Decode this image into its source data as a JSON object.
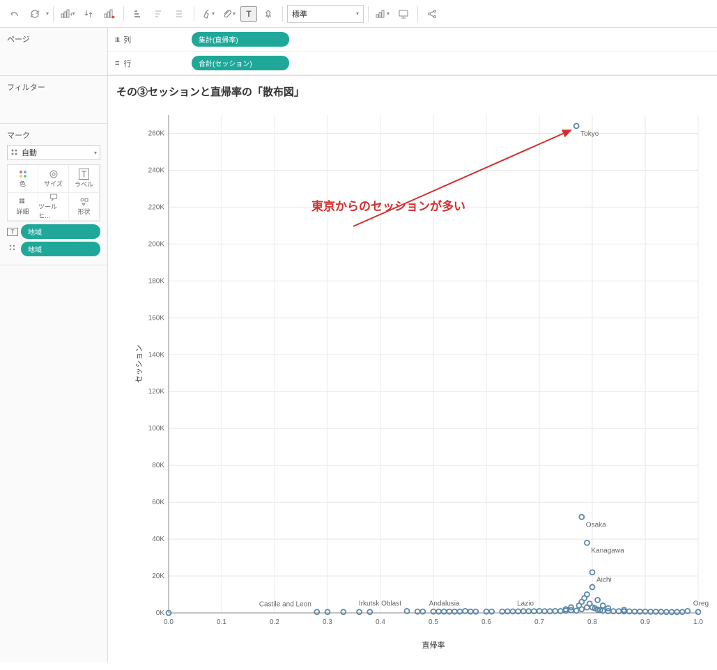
{
  "toolbar": {
    "fit_label": "標準"
  },
  "sidebar": {
    "pages_title": "ページ",
    "filters_title": "フィルター",
    "marks_title": "マーク",
    "marks_type": "自動",
    "cells": {
      "color": "色",
      "size": "サイズ",
      "label": "ラベル",
      "detail": "詳細",
      "tooltip": "ツールヒ…",
      "shape": "形状"
    },
    "pill_label": "地域",
    "pill_detail": "地域"
  },
  "shelves": {
    "columns_label": "列",
    "columns_pill": "集計(直帰率)",
    "rows_label": "行",
    "rows_pill": "合計(セッション)"
  },
  "chart": {
    "title": "その③セッションと直帰率の「散布図」",
    "xlabel": "直帰率",
    "ylabel": "セッション",
    "annotation_text": "東京からのセッションが多い"
  },
  "chart_data": {
    "type": "scatter",
    "title": "その③セッションと直帰率の「散布図」",
    "xlabel": "直帰率",
    "ylabel": "セッション",
    "xlim": [
      0.0,
      1.0
    ],
    "ylim": [
      0,
      270000
    ],
    "xticks": [
      0.0,
      0.1,
      0.2,
      0.3,
      0.4,
      0.5,
      0.6,
      0.7,
      0.8,
      0.9,
      1.0
    ],
    "yticks": [
      0,
      20000,
      40000,
      60000,
      80000,
      100000,
      120000,
      140000,
      160000,
      180000,
      200000,
      220000,
      240000,
      260000
    ],
    "reference_line_x": 0.0,
    "labeled_points": [
      {
        "label": "Tokyo",
        "x": 0.77,
        "y": 264000
      },
      {
        "label": "Osaka",
        "x": 0.78,
        "y": 52000
      },
      {
        "label": "Kanagawa",
        "x": 0.79,
        "y": 38000
      },
      {
        "label": "Aichi",
        "x": 0.8,
        "y": 22000
      },
      {
        "label": "Lazio",
        "x": 0.7,
        "y": 1000
      },
      {
        "label": "Andalusia",
        "x": 0.56,
        "y": 1000
      },
      {
        "label": "Irkutsk Oblast",
        "x": 0.45,
        "y": 1000
      },
      {
        "label": "Castile and Leon",
        "x": 0.28,
        "y": 500
      },
      {
        "label": "Oregon",
        "x": 0.98,
        "y": 1000
      }
    ],
    "points": [
      {
        "x": 0.0,
        "y": 0
      },
      {
        "x": 0.28,
        "y": 500
      },
      {
        "x": 0.3,
        "y": 500
      },
      {
        "x": 0.33,
        "y": 500
      },
      {
        "x": 0.36,
        "y": 500
      },
      {
        "x": 0.38,
        "y": 500
      },
      {
        "x": 0.45,
        "y": 1000
      },
      {
        "x": 0.47,
        "y": 700
      },
      {
        "x": 0.48,
        "y": 700
      },
      {
        "x": 0.5,
        "y": 700
      },
      {
        "x": 0.51,
        "y": 700
      },
      {
        "x": 0.52,
        "y": 700
      },
      {
        "x": 0.53,
        "y": 700
      },
      {
        "x": 0.54,
        "y": 700
      },
      {
        "x": 0.55,
        "y": 700
      },
      {
        "x": 0.56,
        "y": 1000
      },
      {
        "x": 0.57,
        "y": 700
      },
      {
        "x": 0.58,
        "y": 700
      },
      {
        "x": 0.6,
        "y": 700
      },
      {
        "x": 0.61,
        "y": 700
      },
      {
        "x": 0.63,
        "y": 700
      },
      {
        "x": 0.64,
        "y": 800
      },
      {
        "x": 0.65,
        "y": 800
      },
      {
        "x": 0.66,
        "y": 800
      },
      {
        "x": 0.67,
        "y": 900
      },
      {
        "x": 0.68,
        "y": 900
      },
      {
        "x": 0.69,
        "y": 900
      },
      {
        "x": 0.7,
        "y": 1000
      },
      {
        "x": 0.71,
        "y": 900
      },
      {
        "x": 0.72,
        "y": 900
      },
      {
        "x": 0.73,
        "y": 1000
      },
      {
        "x": 0.74,
        "y": 1000
      },
      {
        "x": 0.75,
        "y": 1200
      },
      {
        "x": 0.75,
        "y": 2000
      },
      {
        "x": 0.76,
        "y": 1500
      },
      {
        "x": 0.76,
        "y": 3000
      },
      {
        "x": 0.77,
        "y": 1200
      },
      {
        "x": 0.77,
        "y": 264000
      },
      {
        "x": 0.775,
        "y": 4000
      },
      {
        "x": 0.78,
        "y": 2000
      },
      {
        "x": 0.78,
        "y": 52000
      },
      {
        "x": 0.78,
        "y": 6000
      },
      {
        "x": 0.785,
        "y": 8000
      },
      {
        "x": 0.79,
        "y": 3000
      },
      {
        "x": 0.79,
        "y": 38000
      },
      {
        "x": 0.79,
        "y": 10000
      },
      {
        "x": 0.795,
        "y": 5000
      },
      {
        "x": 0.8,
        "y": 22000
      },
      {
        "x": 0.8,
        "y": 3000
      },
      {
        "x": 0.8,
        "y": 14000
      },
      {
        "x": 0.805,
        "y": 2500
      },
      {
        "x": 0.81,
        "y": 1800
      },
      {
        "x": 0.81,
        "y": 7000
      },
      {
        "x": 0.815,
        "y": 1500
      },
      {
        "x": 0.82,
        "y": 1200
      },
      {
        "x": 0.82,
        "y": 4000
      },
      {
        "x": 0.83,
        "y": 1000
      },
      {
        "x": 0.83,
        "y": 2500
      },
      {
        "x": 0.84,
        "y": 900
      },
      {
        "x": 0.85,
        "y": 900
      },
      {
        "x": 0.86,
        "y": 800
      },
      {
        "x": 0.86,
        "y": 1600
      },
      {
        "x": 0.87,
        "y": 800
      },
      {
        "x": 0.88,
        "y": 700
      },
      {
        "x": 0.89,
        "y": 700
      },
      {
        "x": 0.9,
        "y": 700
      },
      {
        "x": 0.91,
        "y": 600
      },
      {
        "x": 0.92,
        "y": 600
      },
      {
        "x": 0.93,
        "y": 600
      },
      {
        "x": 0.94,
        "y": 500
      },
      {
        "x": 0.95,
        "y": 500
      },
      {
        "x": 0.96,
        "y": 500
      },
      {
        "x": 0.97,
        "y": 500
      },
      {
        "x": 0.98,
        "y": 1000
      },
      {
        "x": 1.0,
        "y": 500
      }
    ],
    "annotation": {
      "text": "東京からのセッションが多い",
      "target": {
        "x": 0.77,
        "y": 264000
      }
    }
  }
}
